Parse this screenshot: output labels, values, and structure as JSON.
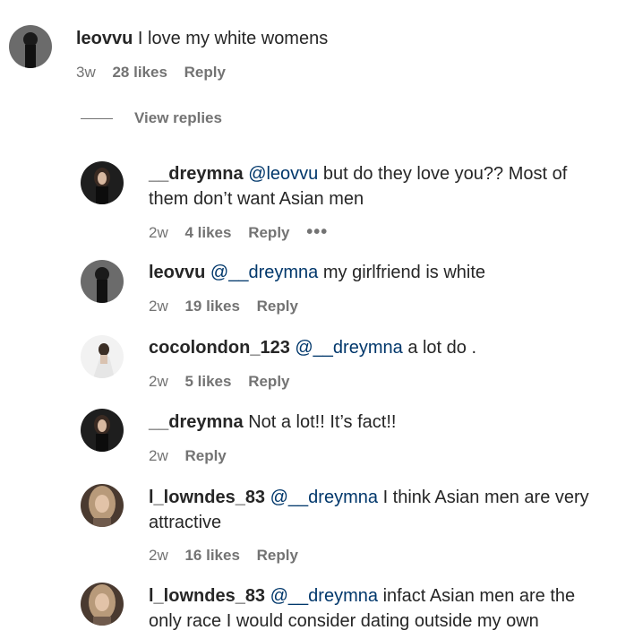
{
  "comments": [
    {
      "user": "leovvu",
      "mention": "",
      "text": "I love my white womens",
      "time": "3w",
      "likes": "28 likes",
      "reply": "Reply",
      "avatar": "dark"
    },
    {
      "user": "__dreymna",
      "mention": "@leovvu",
      "text": "but do they love you?? Most of them don’t want Asian men",
      "time": "2w",
      "likes": "4 likes",
      "reply": "Reply",
      "more": "•••",
      "avatar": "dark-girl"
    },
    {
      "user": "leovvu",
      "mention": "@__dreymna",
      "text": "my girlfriend is white",
      "time": "2w",
      "likes": "19 likes",
      "reply": "Reply",
      "avatar": "dark"
    },
    {
      "user": "cocolondon_123",
      "mention": "@__dreymna",
      "text": "a lot do .",
      "time": "2w",
      "likes": "5 likes",
      "reply": "Reply",
      "avatar": "light"
    },
    {
      "user": "__dreymna",
      "mention": "",
      "text": "Not a lot!! It’s fact!!",
      "time": "2w",
      "likes": "",
      "reply": "Reply",
      "avatar": "dark-girl"
    },
    {
      "user": "l_lowndes_83",
      "mention": "@__dreymna",
      "text": "I think Asian men are very attractive",
      "time": "2w",
      "likes": "16 likes",
      "reply": "Reply",
      "avatar": "blonde"
    },
    {
      "user": "l_lowndes_83",
      "mention": "@__dreymna",
      "text": "infact Asian men are the only race I would consider dating outside my own",
      "avatar": "blonde"
    }
  ],
  "view_replies": "View replies"
}
